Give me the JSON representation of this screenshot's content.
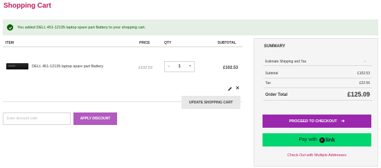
{
  "page": {
    "title": "Shopping Cart"
  },
  "notice": {
    "text": "You added DELL 451-12135 laptop spare part Battery to your shopping cart.",
    "color": "#006400",
    "background": "#e5efe5"
  },
  "cart": {
    "headers": {
      "item": "ITEM",
      "price": "PRICE",
      "qty": "QTY",
      "subtotal": "SUBTOTAL"
    },
    "items": [
      {
        "name": "DELL 451-12135 laptop spare part Battery",
        "price": "£102.53",
        "qty": "1",
        "qty_minus": "−",
        "qty_plus": "+",
        "subtotal": "£102.53",
        "delete_glyph": "✕"
      }
    ],
    "update_label": "UPDATE SHOPPING CART"
  },
  "discount": {
    "placeholder": "Enter discount code",
    "apply_label": "APPLY DISCOUNT"
  },
  "summary": {
    "title": "SUMMARY",
    "estimate_label": "Estimate Shipping and Tax",
    "estimate_chevron": "⌄",
    "rows": [
      {
        "label": "Subtotal",
        "value": "£102.53"
      },
      {
        "label": "Tax",
        "value": "£22.56"
      }
    ],
    "order_total_label": "Order Total",
    "order_total_value": "£125.09",
    "checkout_label": "PROCEED TO CHECKOUT",
    "checkout_arrow": "➜",
    "link_pay_label": "Pay with",
    "link_brand": "link",
    "multi_address_label": "Check Out with Multiple Addresses"
  },
  "colors": {
    "brand": "#c2185b",
    "checkout": "#9b27af",
    "apply": "#b25ac0",
    "link": "#00d66f"
  }
}
